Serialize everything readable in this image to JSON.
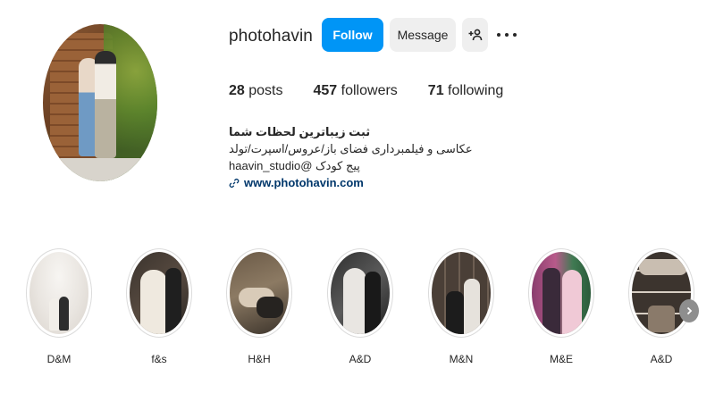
{
  "profile": {
    "username": "photohavin",
    "follow_label": "Follow",
    "message_label": "Message",
    "add_user_icon": "add-user-icon",
    "more_icon": "more-options-icon"
  },
  "stats": {
    "posts_count": "28",
    "posts_label": "posts",
    "followers_count": "457",
    "followers_label": "followers",
    "following_count": "71",
    "following_label": "following"
  },
  "bio": {
    "name": "ثبت زیباترین لحظات شما",
    "line1": "عکاسی و فیلمبرداری فضای باز/عروس/اسپرت/تولد",
    "line2": "haavin_studio@ پیج کودک",
    "link": "www.photohavin.com",
    "link_icon": "link-icon"
  },
  "highlights": [
    {
      "label": "D&M"
    },
    {
      "label": "f&s"
    },
    {
      "label": "H&H"
    },
    {
      "label": "A&D"
    },
    {
      "label": "M&N"
    },
    {
      "label": "M&E"
    },
    {
      "label": "A&D"
    }
  ],
  "colors": {
    "follow_button": "#0095f6",
    "secondary_button": "#efefef",
    "link": "#00376b",
    "text": "#262626"
  }
}
